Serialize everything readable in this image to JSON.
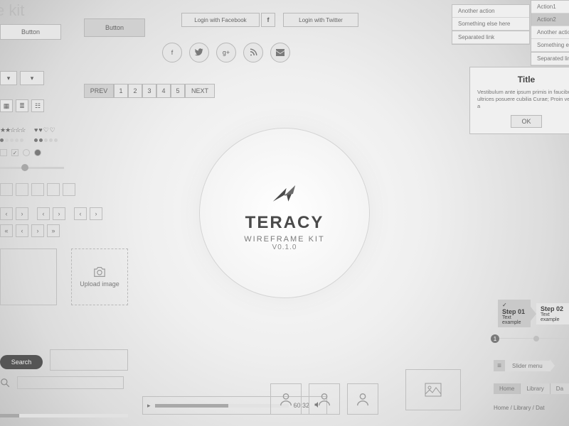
{
  "header": {
    "title_fragment": "e kit"
  },
  "social_login": {
    "facebook_label": "Login with Facebook",
    "fb_icon": "f",
    "twitter_label": "Login with Twitter"
  },
  "buttons": {
    "a": "Button",
    "b": "Button"
  },
  "social_icons": {
    "fb": "f",
    "tw": "t",
    "gp": "g+",
    "rss": "rss",
    "mail": "mail"
  },
  "pagination": {
    "prev": "PREV",
    "p1": "1",
    "p2": "2",
    "p3": "3",
    "p4": "4",
    "p5": "5",
    "next": "NEXT"
  },
  "ratings": {
    "stars": "★★☆☆☆",
    "hearts": "♥♥♡♡"
  },
  "upload": {
    "label": "Upload image"
  },
  "search": {
    "label": "Search"
  },
  "dropdown_left": {
    "items": [
      "Another action",
      "Something else here"
    ],
    "sep": "Separated link"
  },
  "dropdown_right": {
    "items": [
      "Action1",
      "Action2",
      "Another action",
      "Something else"
    ],
    "sep": "Separated link"
  },
  "dialog": {
    "title": "Title",
    "body": "Vestibulum ante ipsum primis in faucibus ultrices posuere cubilia Curae; Proin vel a",
    "ok": "OK"
  },
  "brand": {
    "name": "TERACY",
    "sub": "WIREFRAME KIT",
    "version": "V0.1.0"
  },
  "player": {
    "time": "60:32"
  },
  "steps": [
    {
      "title": "Step 01",
      "sub": "Text example"
    },
    {
      "title": "Step 02",
      "sub": "Text example"
    }
  ],
  "slider_menu": "Slider menu",
  "breadcrumbs1": [
    "Home",
    "Library",
    "Da"
  ],
  "breadcrumbs2": "Home / Library / Dat"
}
